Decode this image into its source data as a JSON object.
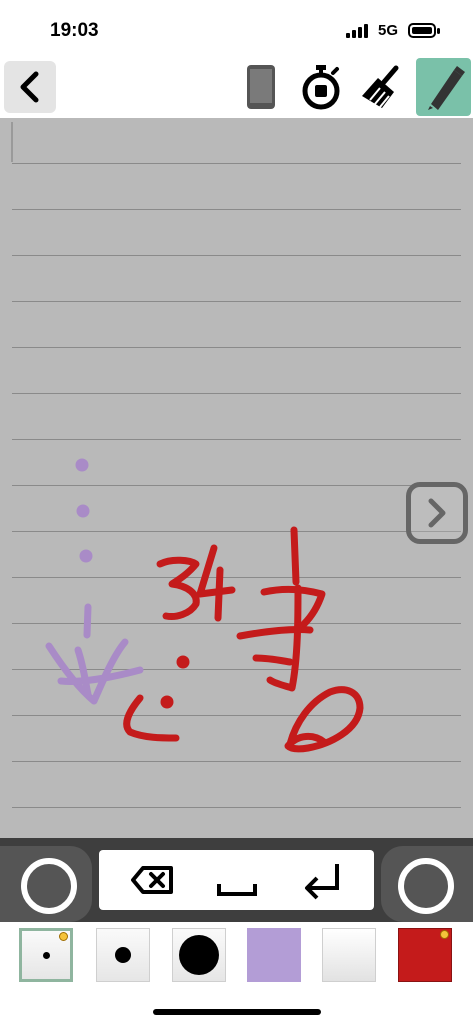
{
  "status_bar": {
    "time": "19:03",
    "network": "5G"
  },
  "toolbar": {
    "back_icon": "chevron-left-icon",
    "tools": [
      "phone-icon",
      "stopwatch-icon",
      "broom-icon",
      "pencil-icon"
    ],
    "active_tool": "pencil-icon"
  },
  "canvas": {
    "ruled_lines": 15,
    "next_icon": "chevron-right-icon",
    "ink_colors": {
      "purple": "#a98bc7",
      "red": "#c41b1b"
    }
  },
  "keyboard": {
    "keys": [
      "backspace-icon",
      "space-icon",
      "return-icon"
    ]
  },
  "palette": {
    "swatches": [
      {
        "kind": "pen-size-small",
        "selected": true
      },
      {
        "kind": "pen-size-medium",
        "selected": false
      },
      {
        "kind": "pen-size-large",
        "selected": false
      },
      {
        "kind": "color",
        "color": "#b39dd6",
        "selected": false
      },
      {
        "kind": "color",
        "color": "#f0f0f0",
        "selected": false
      },
      {
        "kind": "color",
        "color": "#c41b1b",
        "selected": false
      }
    ]
  }
}
